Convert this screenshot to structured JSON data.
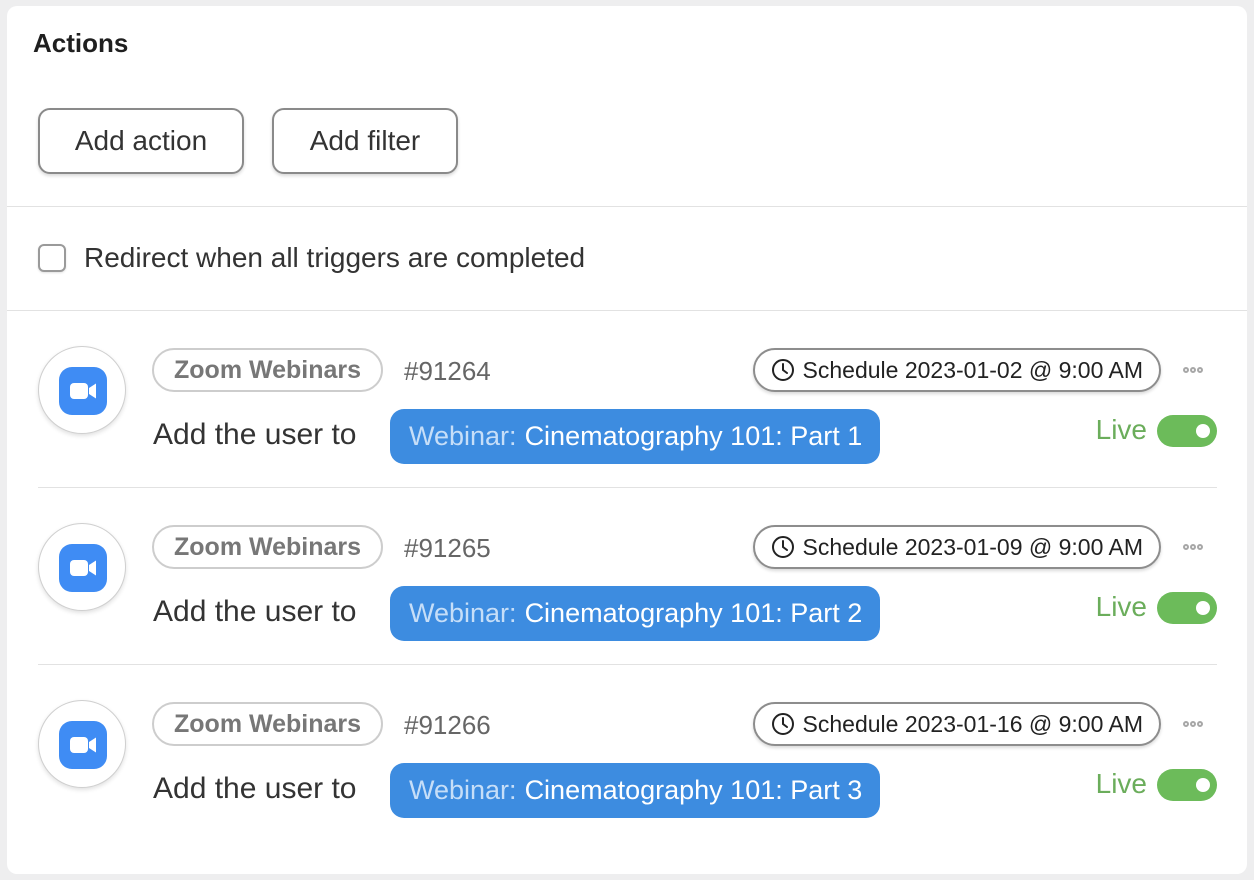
{
  "section": {
    "title": "Actions",
    "add_action_label": "Add action",
    "add_filter_label": "Add filter",
    "redirect_label": "Redirect when all triggers are completed",
    "redirect_checked": false
  },
  "actions": [
    {
      "service": "Zoom Webinars",
      "id": "#91264",
      "schedule": "Schedule 2023-01-02 @ 9:00 AM",
      "description": "Add the user to",
      "target_prefix": "Webinar:",
      "target_name": "Cinematography 101: Part 1",
      "status": "Live",
      "enabled": true
    },
    {
      "service": "Zoom Webinars",
      "id": "#91265",
      "schedule": "Schedule 2023-01-09 @ 9:00 AM",
      "description": "Add the user to",
      "target_prefix": "Webinar:",
      "target_name": "Cinematography 101: Part 2",
      "status": "Live",
      "enabled": true
    },
    {
      "service": "Zoom Webinars",
      "id": "#91266",
      "schedule": "Schedule 2023-01-16 @ 9:00 AM",
      "description": "Add the user to",
      "target_prefix": "Webinar:",
      "target_name": "Cinematography 101: Part 3",
      "status": "Live",
      "enabled": true
    }
  ],
  "colors": {
    "target_pill": "#3d8ce0",
    "live": "#6bad5b",
    "toggle_on": "#6cbb5a",
    "zoom_brand": "#3f8cf4"
  },
  "icons": {
    "service": "zoom-video-icon",
    "schedule": "clock-icon",
    "more": "more-horizontal-icon"
  }
}
